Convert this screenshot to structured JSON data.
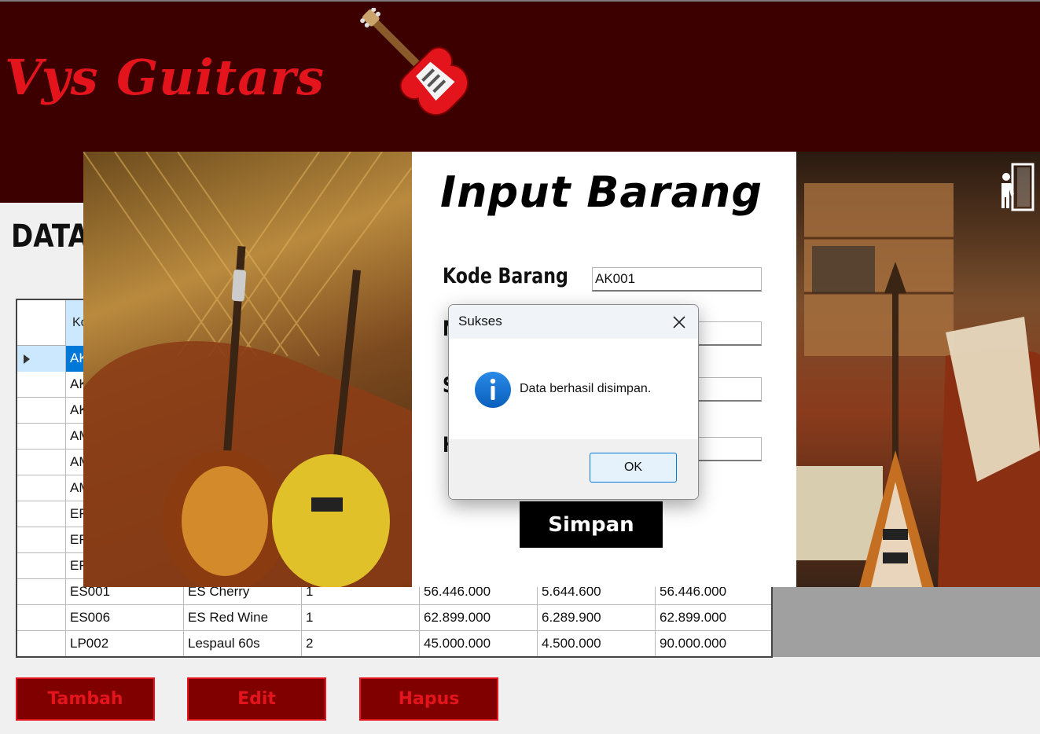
{
  "header": {
    "brand": "Vys Guitars"
  },
  "page": {
    "title": "DATA"
  },
  "grid": {
    "header_partial": "Ko",
    "rows": [
      {
        "c0": "AK",
        "c1": "",
        "c2": "",
        "c3": "",
        "c4": "",
        "c5": "",
        "selected": true
      },
      {
        "c0": "AK",
        "c1": "",
        "c2": "",
        "c3": "",
        "c4": "",
        "c5": ""
      },
      {
        "c0": "AK",
        "c1": "",
        "c2": "",
        "c3": "",
        "c4": "",
        "c5": ""
      },
      {
        "c0": "AM",
        "c1": "",
        "c2": "",
        "c3": "",
        "c4": "",
        "c5": ""
      },
      {
        "c0": "AM",
        "c1": "",
        "c2": "",
        "c3": "",
        "c4": "",
        "c5": ""
      },
      {
        "c0": "AM",
        "c1": "",
        "c2": "",
        "c3": "",
        "c4": "",
        "c5": ""
      },
      {
        "c0": "EF",
        "c1": "",
        "c2": "",
        "c3": "",
        "c4": "",
        "c5": ""
      },
      {
        "c0": "EF",
        "c1": "",
        "c2": "",
        "c3": "",
        "c4": "",
        "c5": ""
      },
      {
        "c0": "EF",
        "c1": "",
        "c2": "",
        "c3": "",
        "c4": "",
        "c5": ""
      },
      {
        "c0": "ES001",
        "c1": "ES Cherry",
        "c2": "1",
        "c3": "56.446.000",
        "c4": "5.644.600",
        "c5": "56.446.000"
      },
      {
        "c0": "ES006",
        "c1": "ES Red Wine",
        "c2": "1",
        "c3": "62.899.000",
        "c4": "6.289.900",
        "c5": "62.899.000"
      },
      {
        "c0": "LP002",
        "c1": "Lespaul 60s",
        "c2": "2",
        "c3": "45.000.000",
        "c4": "4.500.000",
        "c5": "90.000.000"
      }
    ]
  },
  "buttons": {
    "tambah": "Tambah",
    "edit": "Edit",
    "hapus": "Hapus"
  },
  "form": {
    "title": "Input Barang",
    "label_kode": "Kode Barang",
    "label_2_partial": "N",
    "label_3_partial": "S",
    "label_4_partial": "H",
    "kode_value": "AK001",
    "simpan": "Simpan"
  },
  "dialog": {
    "title": "Sukses",
    "message": "Data berhasil disimpan.",
    "ok": "OK",
    "icon": "info-icon"
  },
  "colors": {
    "header_bg": "#3d0000",
    "brand_red": "#e3141c",
    "button_bg": "#800000",
    "selection": "#0078d7"
  }
}
